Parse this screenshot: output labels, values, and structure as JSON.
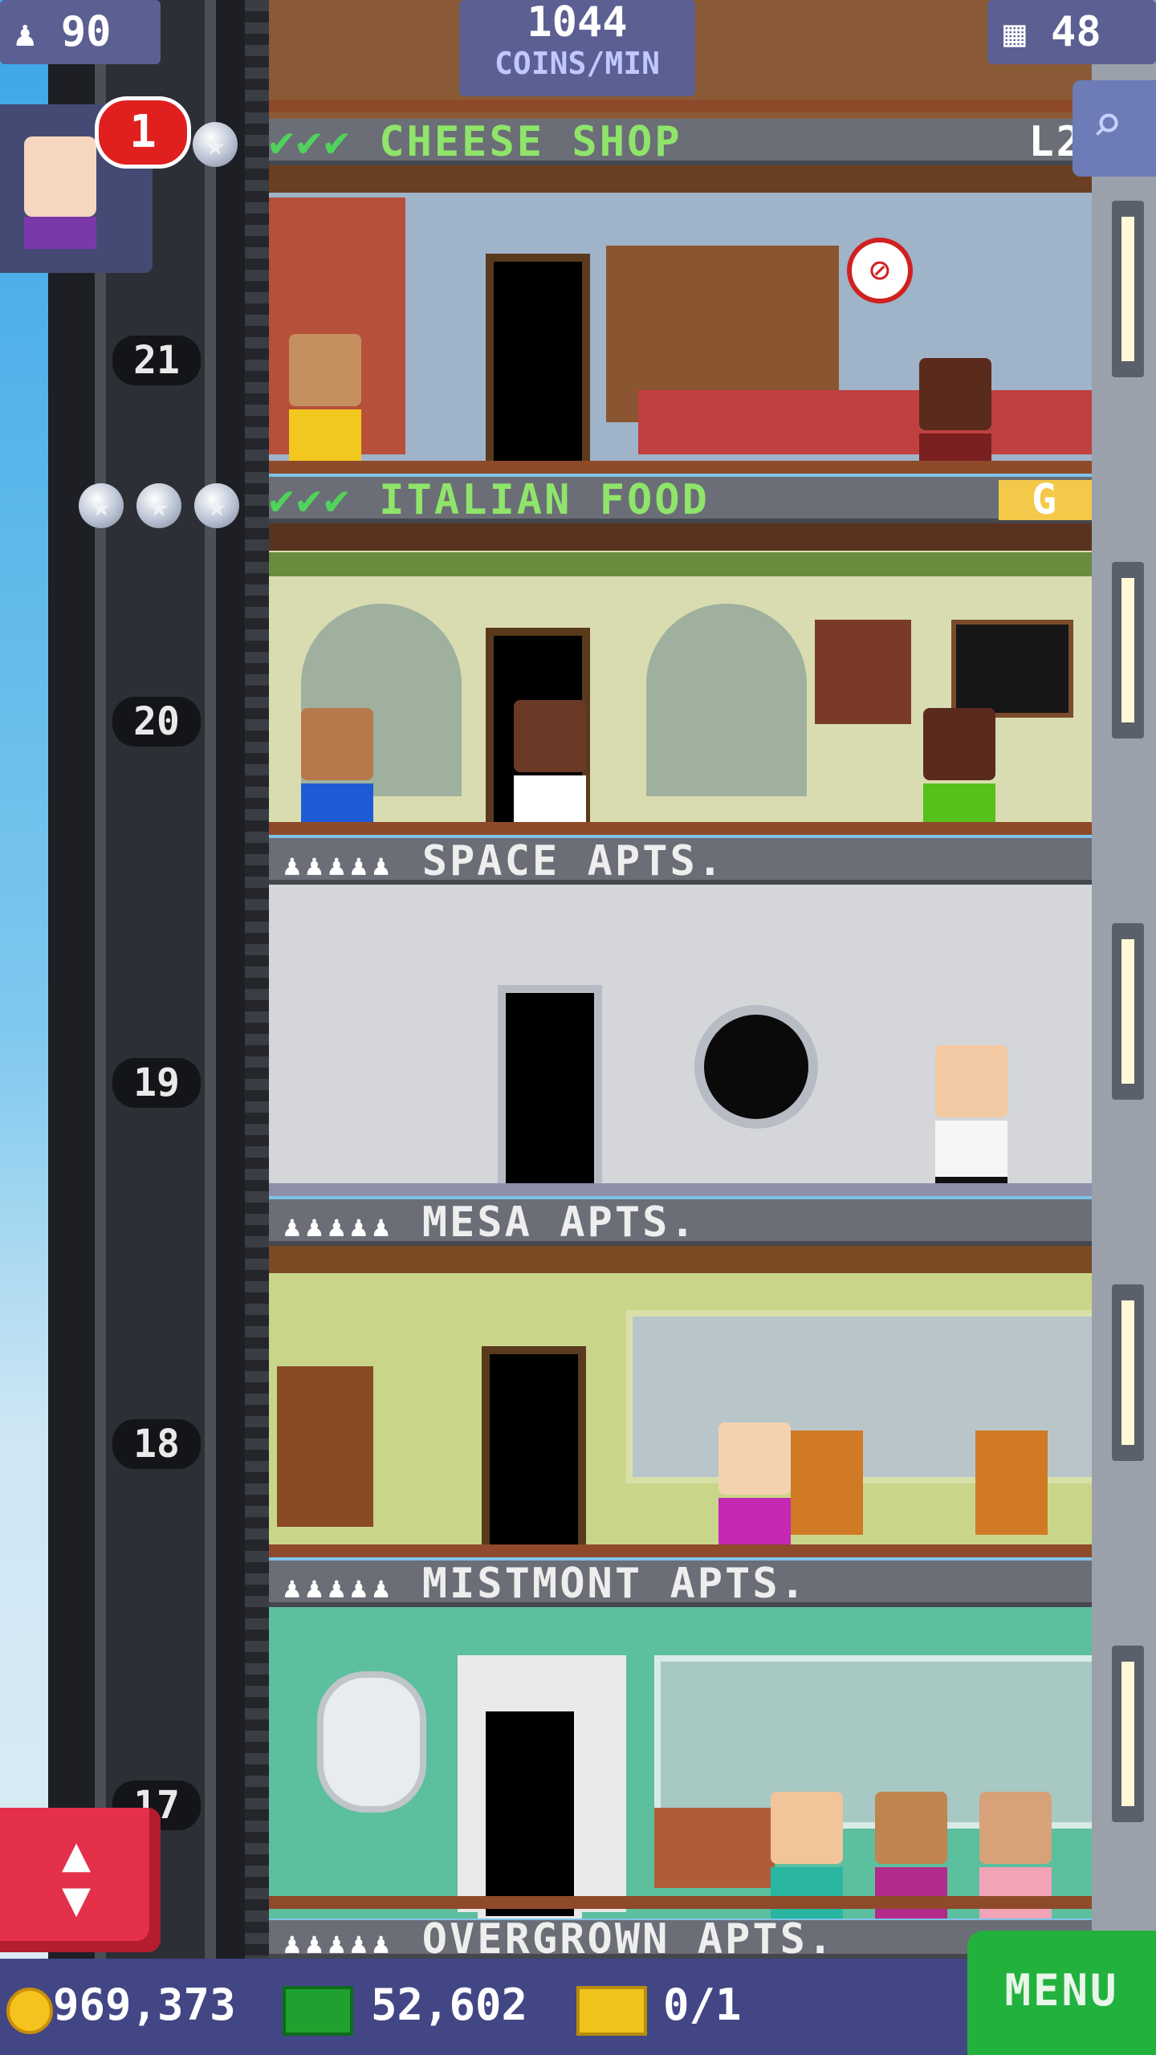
{
  "hud": {
    "population": "90",
    "coins_rate": "1044",
    "coins_rate_unit": "COINS/MIN",
    "floor_count": "48",
    "notification_count": "1"
  },
  "floors": [
    {
      "label": "CHEESE SHOP",
      "checks": "✔✔✔",
      "side_tag": "L2",
      "number": "21"
    },
    {
      "label": "ITALIAN FOOD",
      "checks": "✔✔✔",
      "side_tag": "G",
      "number": "20"
    },
    {
      "label": "SPACE APTS.",
      "people": "♟♟♟♟♟",
      "number": "19"
    },
    {
      "label": "MESA APTS.",
      "people": "♟♟♟♟♟",
      "number": "18"
    },
    {
      "label": "MISTMONT APTS.",
      "people": "♟♟♟♟♟",
      "number": "17"
    },
    {
      "label": "OVERGROWN APTS.",
      "people": "♟♟♟♟♟"
    }
  ],
  "bottom_bar": {
    "coins": "969,373",
    "bux": "52,602",
    "tickets": "0/1",
    "menu_label": "MENU"
  },
  "icons": {
    "population": "person-icon",
    "floors": "building-icon",
    "search": "magnifier-icon",
    "elevator": "up-down-arrows-icon",
    "coin": "coin-icon",
    "bux": "banknote-icon",
    "ticket": "ticket-icon"
  },
  "colors": {
    "hud": "#5b5f92",
    "bottom_bar": "#424685",
    "menu": "#23b13e",
    "elevator_button": "#e4304a",
    "check_green": "#4fd35a"
  }
}
